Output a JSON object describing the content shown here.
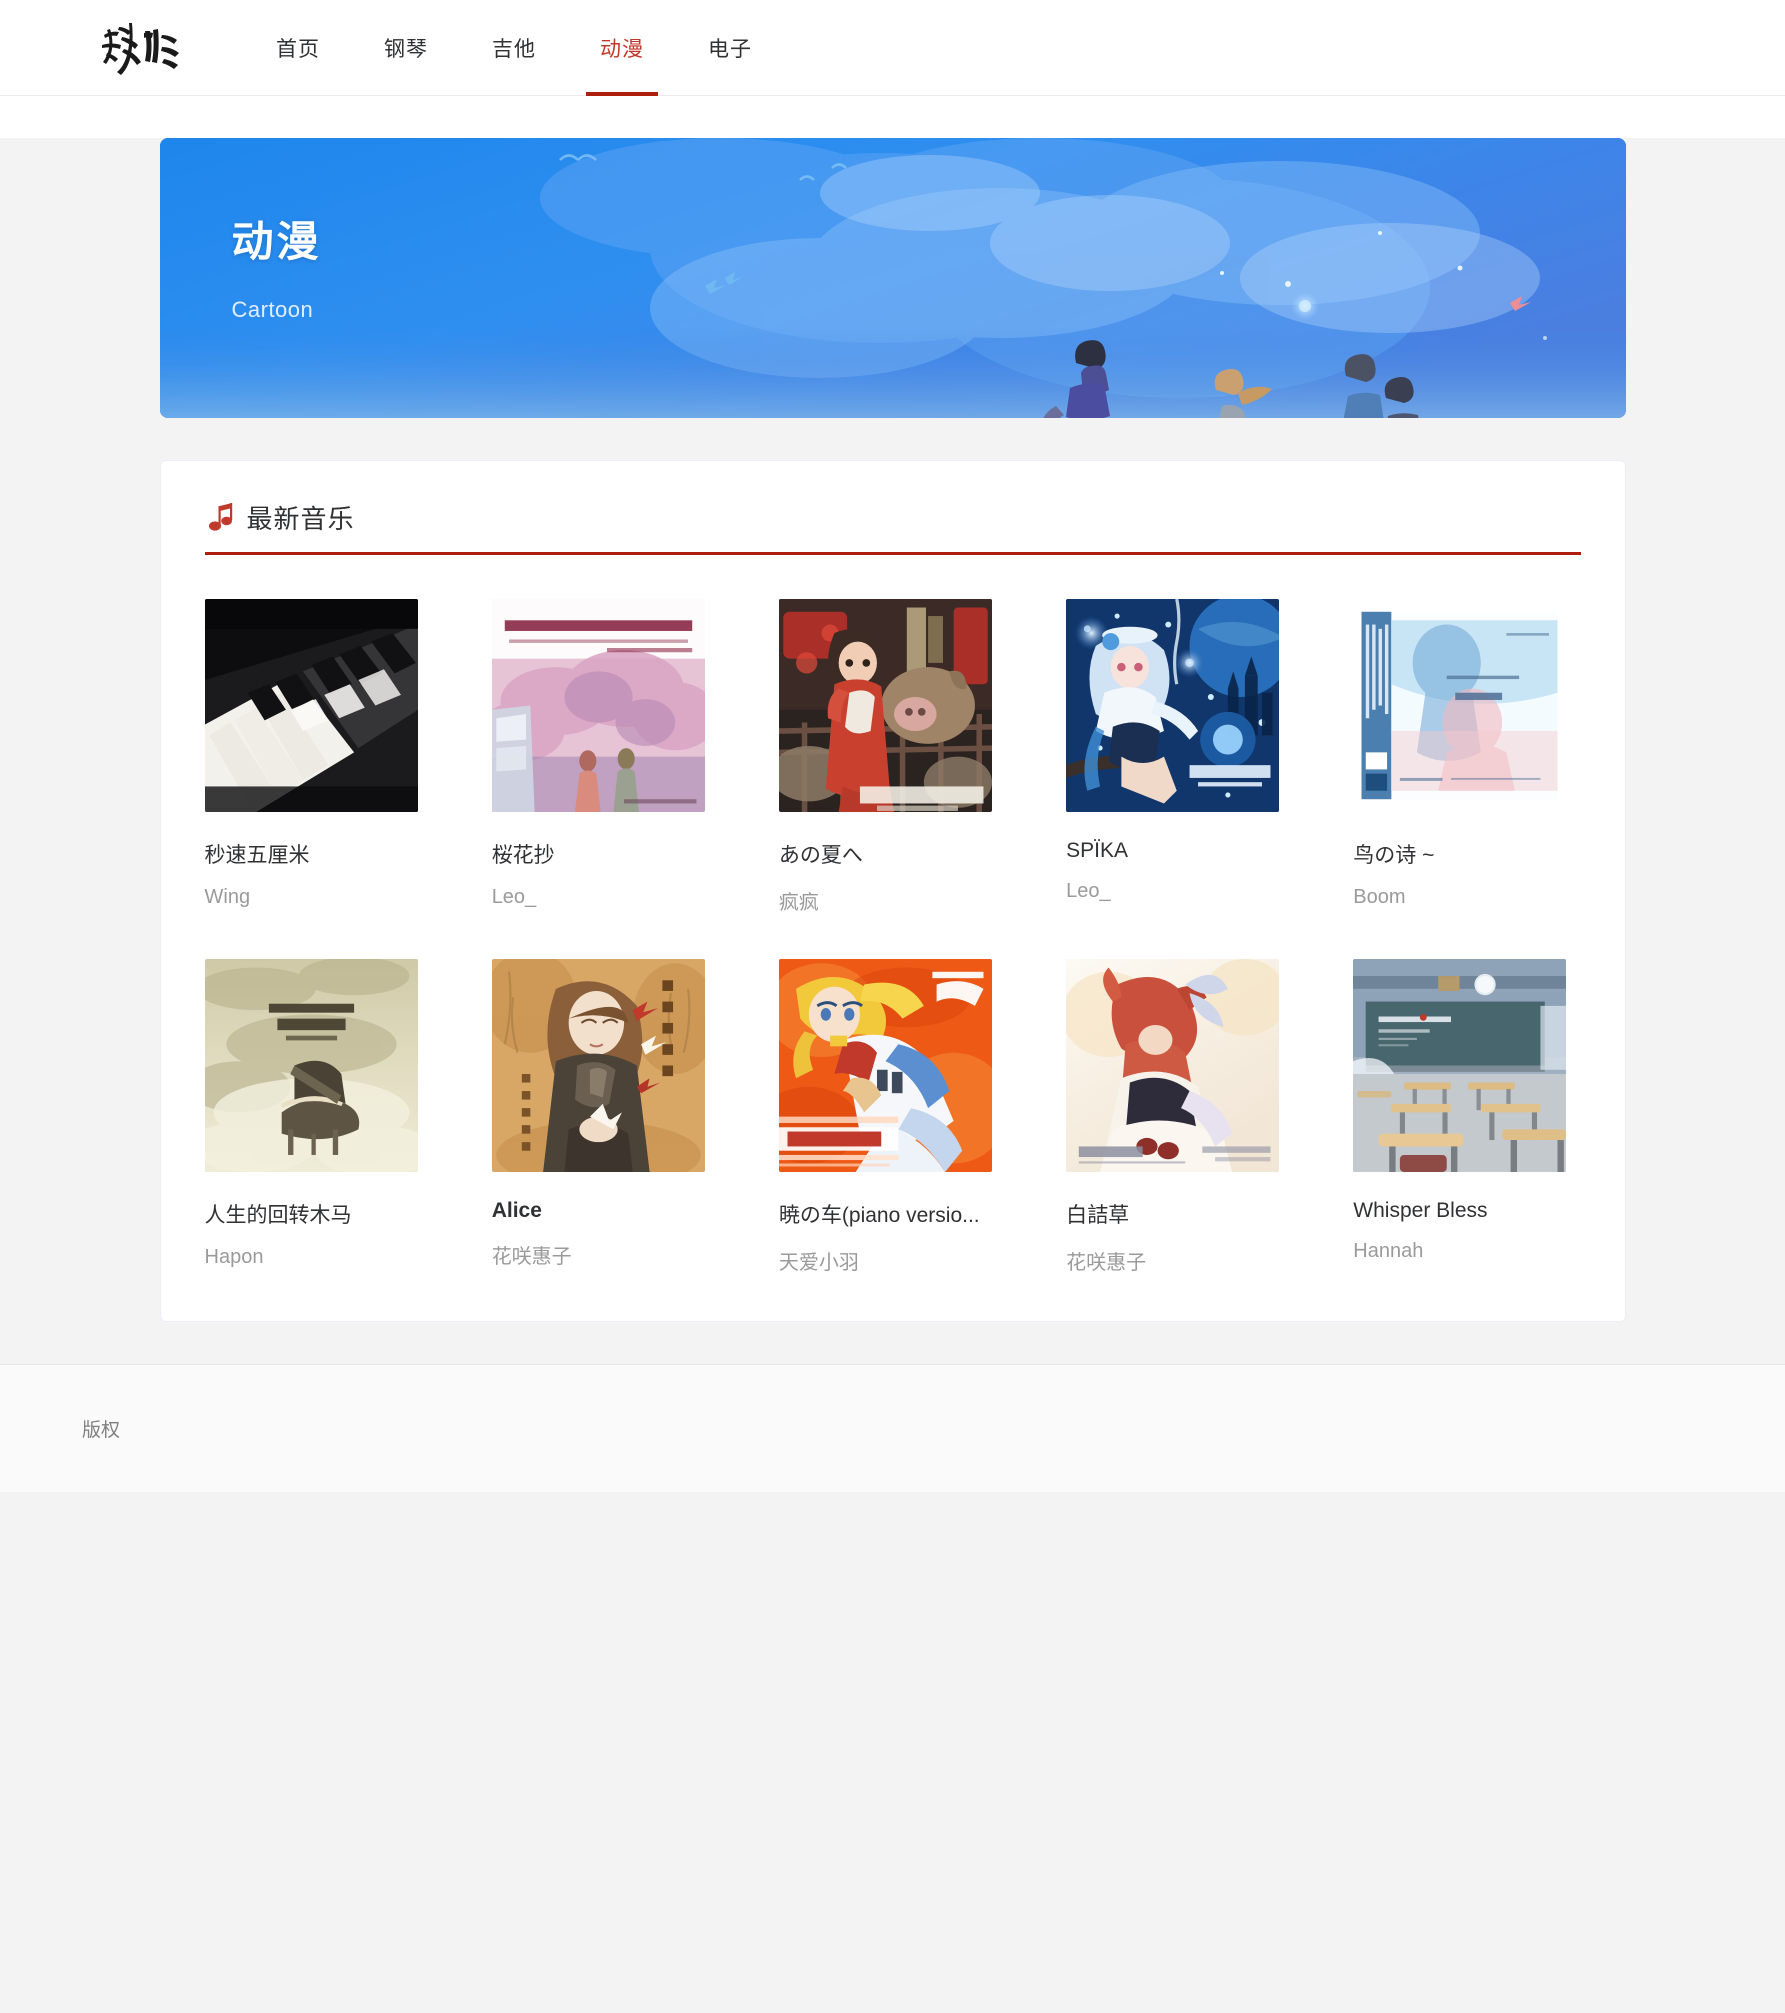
{
  "nav": {
    "logo_text": "静听",
    "logo_name": "calligraphy-logo",
    "items": [
      {
        "label": "首页",
        "active": false
      },
      {
        "label": "钢琴",
        "active": false
      },
      {
        "label": "吉他",
        "active": false
      },
      {
        "label": "动漫",
        "active": true
      },
      {
        "label": "电子",
        "active": false
      }
    ],
    "active_color": "#c0392b",
    "underline_color": "#b01e10"
  },
  "banner": {
    "title": "动漫",
    "subtitle": "Cartoon",
    "bg_color": "#2a8ced",
    "art_description": "anime-sky-silhouettes"
  },
  "section": {
    "icon": "music-note-icon",
    "title": "最新音乐",
    "accent_color": "#b01e10"
  },
  "songs": [
    {
      "title": "秒速五厘米",
      "artist": "Wing",
      "cover": "piano-keys",
      "bold": false
    },
    {
      "title": "桜花抄",
      "artist": "Leo_",
      "cover": "5cm-per-second",
      "bold": false
    },
    {
      "title": "あの夏へ",
      "artist": "疯疯",
      "cover": "spirited-away",
      "bold": false
    },
    {
      "title": "SPÏKA",
      "artist": "Leo_",
      "cover": "lengsel-blue",
      "bold": false
    },
    {
      "title": "鸟の诗 ~",
      "artist": "Boom",
      "cover": "re-feel",
      "bold": false
    },
    {
      "title": "人生的回转木马",
      "artist": "Hapon",
      "cover": "hisaishi-freedom",
      "bold": false
    },
    {
      "title": "Alice",
      "artist": "花咲惠子",
      "cover": "kaeshiuta-sepia",
      "bold": true
    },
    {
      "title": "暁の车(piano versio...",
      "artist": "天爱小羽",
      "cover": "akatsuki-no-kuruma",
      "bold": false
    },
    {
      "title": "白詰草",
      "artist": "花咲惠子",
      "cover": "clannad-ost",
      "bold": false
    },
    {
      "title": "Whisper Bless",
      "artist": "Hannah",
      "cover": "classroom",
      "bold": false
    }
  ],
  "footer": {
    "text": "版权"
  }
}
